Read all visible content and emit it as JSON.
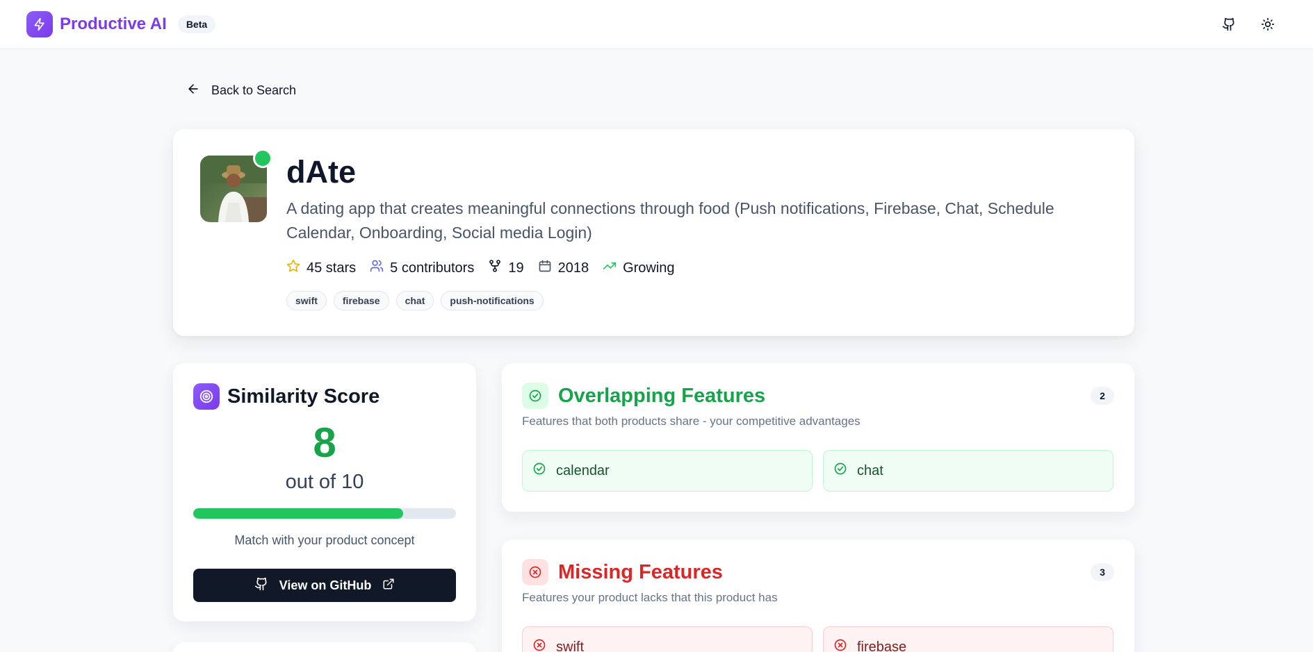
{
  "header": {
    "brand": "Productive AI",
    "badge": "Beta"
  },
  "nav": {
    "back_label": "Back to Search"
  },
  "repo": {
    "name": "dAte",
    "description": "A dating app that creates meaningful connections through food (Push notifications, Firebase, Chat, Schedule Calendar, Onboarding, Social media Login)",
    "stats": {
      "stars": "45 stars",
      "contributors": "5 contributors",
      "forks": "19",
      "year": "2018",
      "trend": "Growing"
    },
    "tags": [
      "swift",
      "firebase",
      "chat",
      "push-notifications"
    ]
  },
  "similarity": {
    "title": "Similarity Score",
    "score": "8",
    "out_of": "out of 10",
    "progress_fraction": 0.8,
    "caption": "Match with your product concept",
    "button_label": "View on GitHub"
  },
  "overlapping": {
    "title": "Overlapping Features",
    "count": "2",
    "subtitle": "Features that both products share - your competitive advantages",
    "items": [
      "calendar",
      "chat"
    ]
  },
  "missing": {
    "title": "Missing Features",
    "count": "3",
    "subtitle": "Features your product lacks that this product has",
    "items": [
      "swift",
      "firebase"
    ]
  },
  "colors": {
    "brand": "#7c3aed",
    "success": "#16a34a",
    "danger": "#dc2626",
    "dark_button": "#111827"
  },
  "icons": {
    "brand": "lightning-icon",
    "github": "github-icon",
    "theme": "sun-icon",
    "back": "arrow-left-icon",
    "stars": "star-icon",
    "contributors": "users-icon",
    "forks": "fork-icon",
    "year": "calendar-icon",
    "trend": "trending-up-icon",
    "similarity": "target-icon",
    "external": "external-link-icon",
    "overlap": "check-circle-icon",
    "missing": "x-circle-icon"
  }
}
